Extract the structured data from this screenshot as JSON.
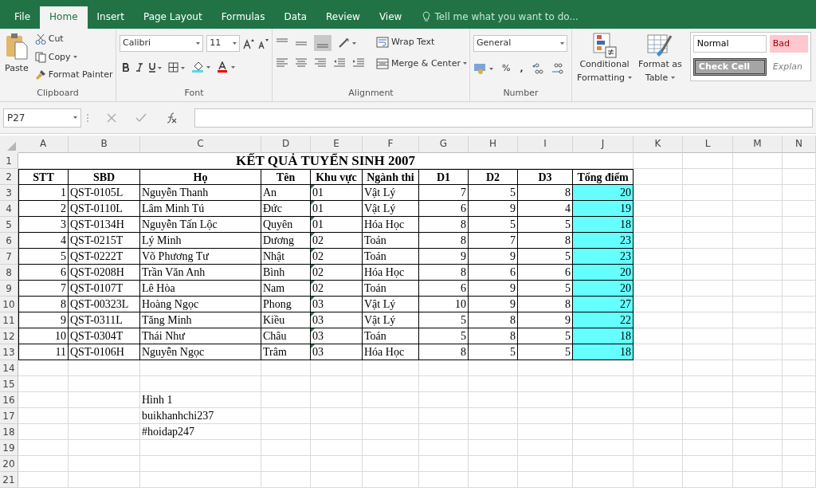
{
  "menu_tabs": [
    {
      "label": "File",
      "selected": false
    },
    {
      "label": "Home",
      "selected": true
    },
    {
      "label": "Insert",
      "selected": false
    },
    {
      "label": "Page Layout",
      "selected": false
    },
    {
      "label": "Formulas",
      "selected": false
    },
    {
      "label": "Data",
      "selected": false
    },
    {
      "label": "Review",
      "selected": false
    },
    {
      "label": "View",
      "selected": false
    }
  ],
  "tell_me": "Tell me what you want to do...",
  "clipboard": {
    "paste": "Paste",
    "cut": "Cut",
    "copy": "Copy",
    "format_painter": "Format Painter",
    "label": "Clipboard"
  },
  "font": {
    "name": "Calibri",
    "size": "11",
    "label": "Font"
  },
  "alignment": {
    "wrap_text": "Wrap Text",
    "merge_center": "Merge & Center",
    "label": "Alignment"
  },
  "number": {
    "format": "General",
    "percent": "%",
    "comma": ",",
    "label": "Number"
  },
  "styles": {
    "conditional_formatting": [
      "Conditional",
      "Formatting"
    ],
    "format_as_table": [
      "Format as",
      "Table"
    ],
    "cell_styles": [
      {
        "name": "Normal",
        "kind": "normal"
      },
      {
        "name": "Bad",
        "kind": "bad"
      },
      {
        "name": "Check Cell",
        "kind": "check"
      },
      {
        "name": "Explan",
        "kind": "explanatory"
      }
    ]
  },
  "name_box": "P27",
  "columns": [
    "A",
    "B",
    "C",
    "D",
    "E",
    "F",
    "G",
    "H",
    "I",
    "J",
    "K",
    "L",
    "M",
    "N"
  ],
  "sheet": {
    "title": "KẾT QUẢ TUYỂN SINH 2007",
    "headers": [
      {
        "text": "STT",
        "kind": "number"
      },
      {
        "text": "SBD",
        "kind": "text"
      },
      {
        "text": "Họ",
        "kind": "text"
      },
      {
        "text": "Tên",
        "kind": "text"
      },
      {
        "text": "Khu vực",
        "kind": "code"
      },
      {
        "text": "Ngành thi",
        "kind": "text"
      },
      {
        "text": "D1",
        "kind": "number"
      },
      {
        "text": "D2",
        "kind": "number"
      },
      {
        "text": "D3",
        "kind": "number"
      },
      {
        "text": "Tổng điểm",
        "kind": "total"
      }
    ],
    "rows": [
      [
        "1",
        "QST-0105L",
        "Nguyễn Thanh",
        " An",
        "01",
        "Vật Lý",
        "7",
        "5",
        "8",
        "20"
      ],
      [
        "2",
        "QST-0110L",
        "Lâm Minh Tú",
        "Đức",
        "01",
        "Vật Lý",
        "6",
        "9",
        "4",
        "19"
      ],
      [
        "3",
        "QST-0134H",
        "Nguyễn Tấn Lộc",
        "Quyên",
        "01",
        "Hóa Học",
        "8",
        "5",
        "5",
        "18"
      ],
      [
        "4",
        "QST-0215T",
        "Lý Minh",
        "Dương",
        "02",
        "Toán",
        "8",
        "7",
        "8",
        "23"
      ],
      [
        "5",
        "QST-0222T",
        "Võ Phương Tư",
        "Nhật",
        "02",
        "Toán",
        "9",
        "9",
        "5",
        "23"
      ],
      [
        "6",
        "QST-0208H",
        "Trần Văn Anh",
        "Bình",
        "02",
        "Hóa Học",
        "8",
        "6",
        "6",
        "20"
      ],
      [
        "7",
        "QST-0107T",
        "Lê Hòa",
        "Nam",
        "02",
        "Toán",
        "6",
        "9",
        "5",
        "20"
      ],
      [
        "8",
        "QST-00323L",
        "Hoàng Ngọc",
        " Phong",
        "03",
        "Vật Lý",
        "10",
        "9",
        "8",
        "27"
      ],
      [
        "9",
        "QST-0311L",
        "Tăng Minh",
        "Kiều",
        "03",
        "Vật Lý",
        "5",
        "8",
        "9",
        "22"
      ],
      [
        "10",
        "QST-0304T",
        "Thái Như",
        "Châu",
        "03",
        "Toán",
        "5",
        "8",
        "5",
        "18"
      ],
      [
        "11",
        "QST-0106H",
        "Nguyễn Ngọc",
        "Trâm",
        "03",
        "Hóa Học",
        "8",
        "5",
        "5",
        "18"
      ]
    ],
    "notes": [
      "Hình 1",
      "buikhanhchi237",
      "#hoidap247"
    ]
  },
  "row_numbers": [
    "1",
    "2",
    "3",
    "4",
    "5",
    "6",
    "7",
    "8",
    "9",
    "10",
    "11",
    "12",
    "13",
    "14",
    "15",
    "16",
    "17",
    "18",
    "19",
    "20",
    "21"
  ]
}
